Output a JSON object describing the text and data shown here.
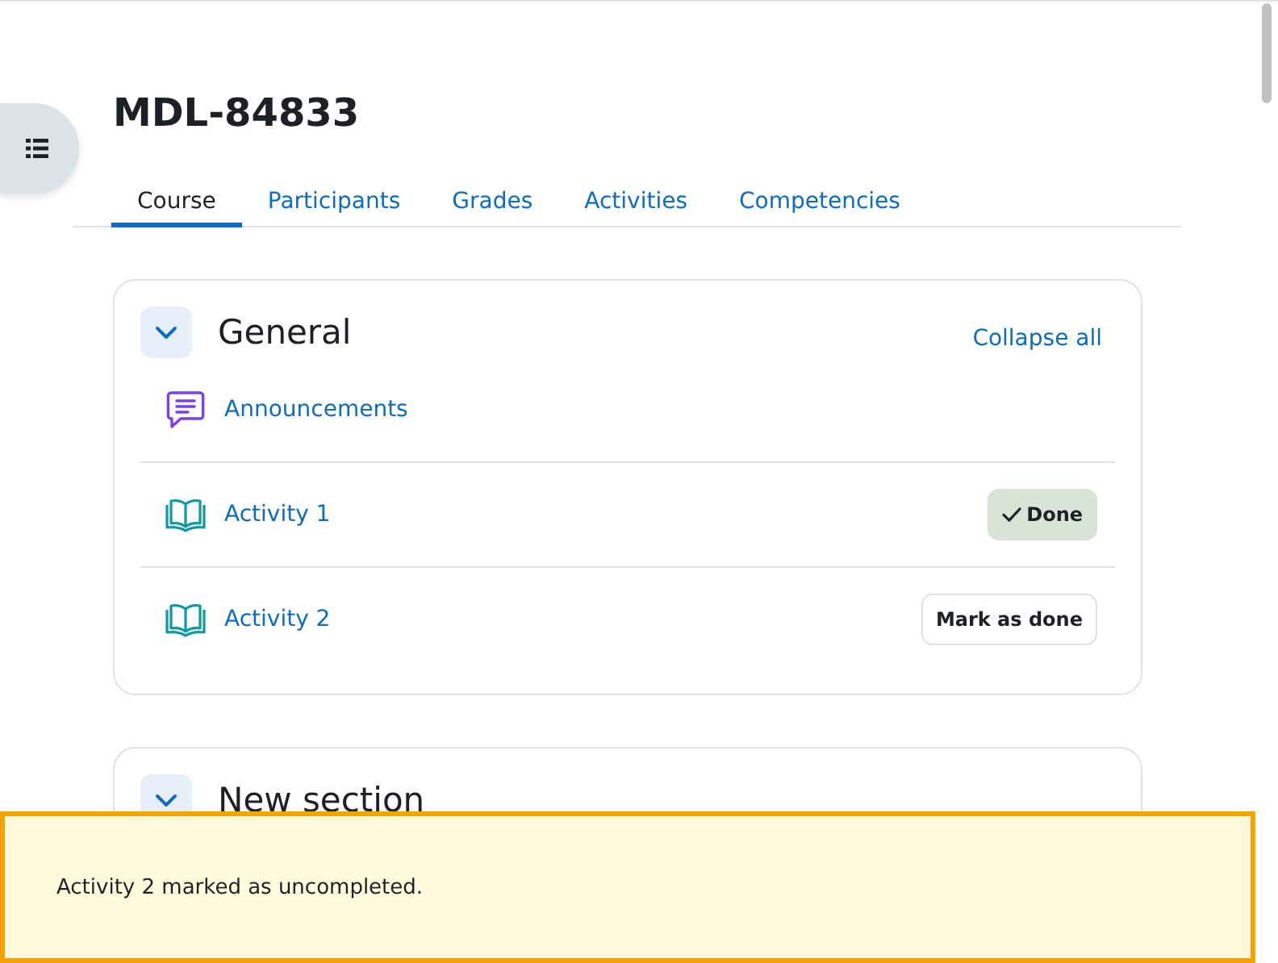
{
  "course_title": "MDL-84833",
  "tabs": [
    {
      "label": "Course",
      "selected": true
    },
    {
      "label": "Participants",
      "selected": false
    },
    {
      "label": "Grades",
      "selected": false
    },
    {
      "label": "Activities",
      "selected": false
    },
    {
      "label": "Competencies",
      "selected": false
    }
  ],
  "sections": [
    {
      "title": "General",
      "expanded": true,
      "action": "Collapse all",
      "activities": [
        {
          "kind": "forum",
          "name": "Announcements"
        },
        {
          "kind": "book",
          "name": "Activity 1",
          "completion": {
            "label": "Done",
            "done": true
          }
        },
        {
          "kind": "book",
          "name": "Activity 2",
          "completion": {
            "label": "Mark as done",
            "done": false
          }
        }
      ]
    },
    {
      "title": "New section",
      "expanded": true
    }
  ],
  "toast": {
    "message": "Activity 2 marked as uncompleted."
  }
}
